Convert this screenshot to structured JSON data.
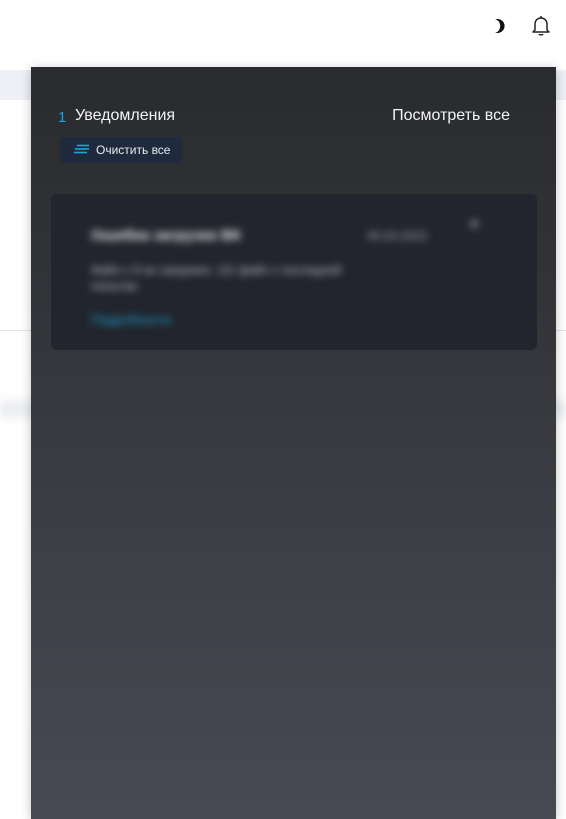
{
  "header": {
    "moon_icon": "moon-icon",
    "bell_icon": "bell-icon"
  },
  "notifications": {
    "count": "1",
    "title": "Уведомления",
    "view_all_label": "Посмотреть все",
    "clear_all_label": "Очистить все",
    "clear_icon": "list-lines-icon",
    "accent_color": "#1ba7dc",
    "items": [
      {
        "title": "Ошибка загрузки ВК",
        "date": "05.03.2023",
        "body": "Файл с 9 не загружен. 111 файл с последней попытки.",
        "link_label": "Подробности"
      }
    ]
  }
}
